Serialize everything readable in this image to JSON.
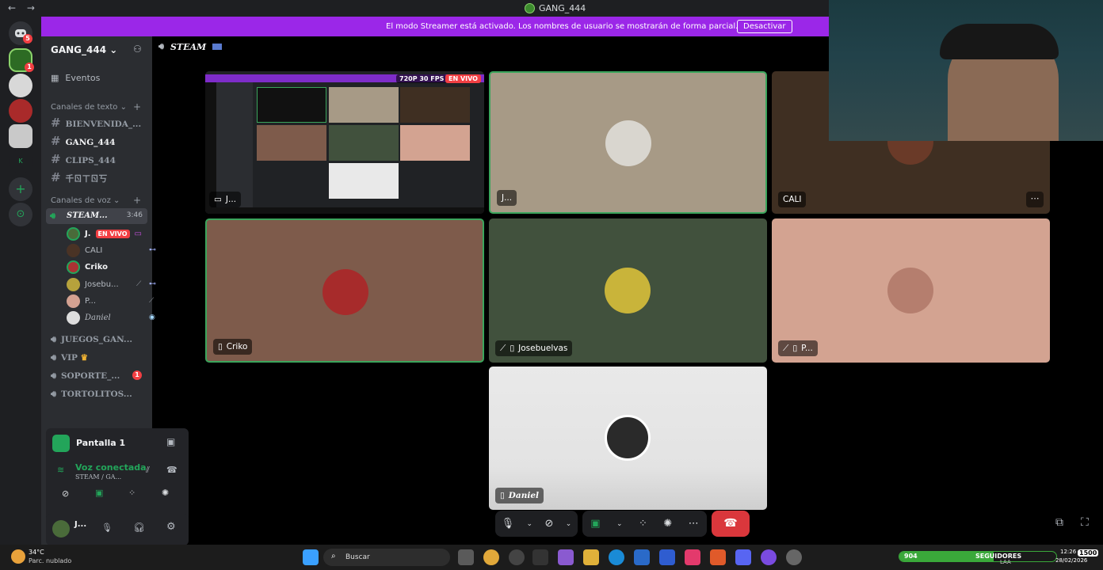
{
  "window": {
    "title": "GANG_444",
    "back": "←",
    "forward": "→"
  },
  "banner": {
    "text": "El modo Streamer está activado. Los nombres de usuario se mostrarán de forma parcial.",
    "button": "Desactivar"
  },
  "rail": {
    "home_badge": "5",
    "server_badge": "1"
  },
  "sidebar": {
    "server_name": "GANG_444",
    "events": "Eventos",
    "text_category": "Canales de texto",
    "text_channels": [
      "BIENVENIDA_...",
      "GANG_444",
      "CLIPS_444",
      "千ㄖㄒㄖ丂"
    ],
    "voice_category": "Canales de voz",
    "active_voice": {
      "name": "STEAM...",
      "time": "3:46"
    },
    "voice_users": [
      {
        "name": "J.",
        "live": "EN VIVO"
      },
      {
        "name": "CALI"
      },
      {
        "name": "Criko"
      },
      {
        "name": "Josebu..."
      },
      {
        "name": "P..."
      },
      {
        "name": "Daniel"
      }
    ],
    "voice_channels": [
      "JUEGOS_GAN...",
      "VIP",
      "SOPORTE_...",
      "TORTOLITOS..."
    ],
    "soporte_badge": "1"
  },
  "screen_panel": {
    "title": "Pantalla 1",
    "status": "Voz conectada",
    "sub": "STEAM / GA..."
  },
  "user_panel": {
    "name": "J..."
  },
  "voice_header": {
    "name": "STEAM"
  },
  "stream_tile": {
    "quality": "720P 30 FPS",
    "live": "EN VIVO",
    "label": "J..."
  },
  "tiles": [
    {
      "label": "J..."
    },
    {
      "label": "CALI"
    },
    {
      "label": "Criko"
    },
    {
      "label": "Josebuelvas"
    },
    {
      "label": "P..."
    },
    {
      "label": "Daniel"
    }
  ],
  "taskbar": {
    "temp": "34°C",
    "weather": "Parc. nublado",
    "search": "Buscar",
    "goal_left": "904",
    "goal_label": "SEGUIDORES",
    "goal_right": "1500",
    "lang": "LAA",
    "clock": "12:26",
    "date": "28/02/2026"
  },
  "colors": {
    "accent": "#9b27e8",
    "speaking": "#3ba55c",
    "danger": "#da373c"
  }
}
